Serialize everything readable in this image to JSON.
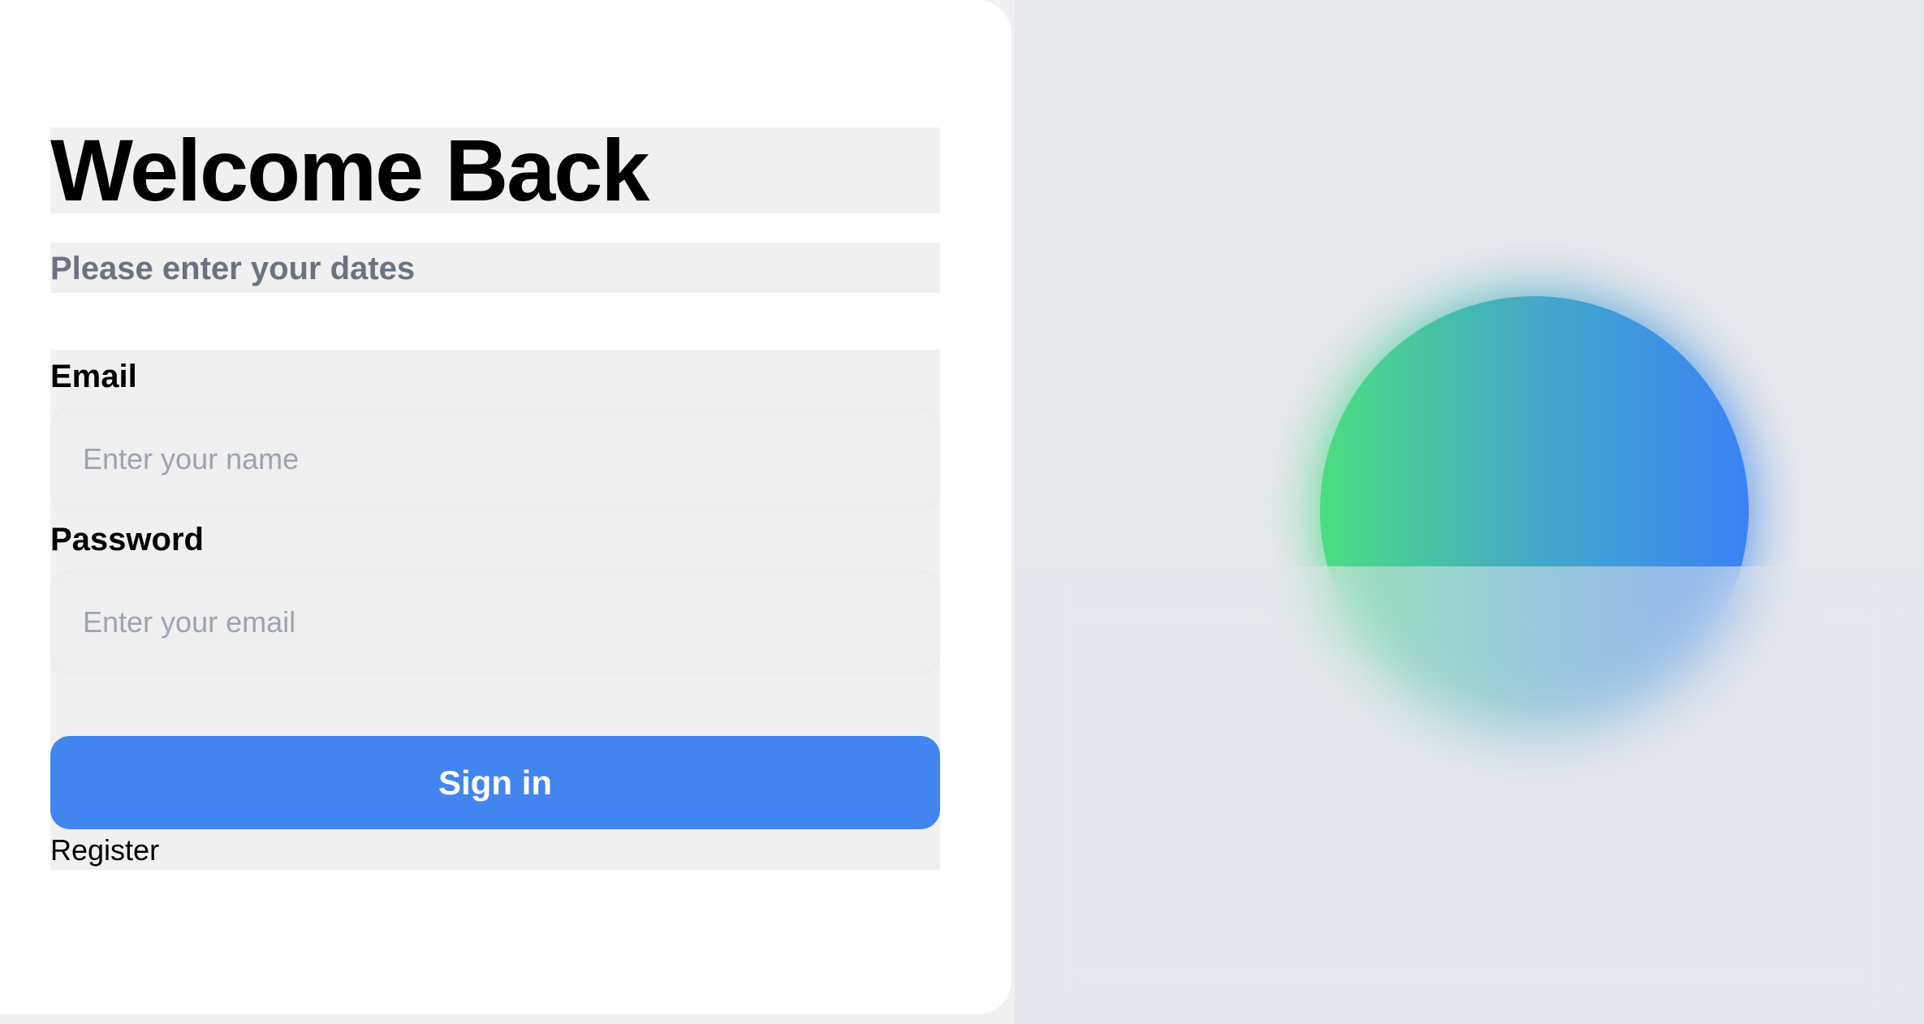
{
  "heading": {
    "title": "Welcome Back",
    "subtitle": "Please enter your dates"
  },
  "form": {
    "email_label": "Email",
    "email_placeholder": "Enter your name",
    "password_label": "Password",
    "password_placeholder": "Enter your email",
    "signin_label": "Sign in",
    "register_label": "Register"
  },
  "colors": {
    "primary": "#4285f0",
    "panel": "#e5e7eb",
    "orb_start": "#4ade80",
    "orb_end": "#3b82f6"
  }
}
